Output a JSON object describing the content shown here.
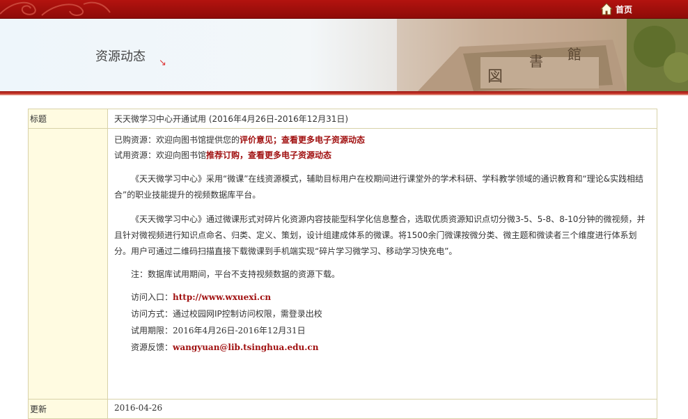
{
  "header": {
    "home_label": "首页"
  },
  "banner": {
    "title": "资源动态",
    "arrow": "↘"
  },
  "record": {
    "title_label": "标题",
    "title_value": "天天微学习中心开通试用 (2016年4月26日-2016年12月31日)",
    "purchased_prefix": "已购资源：欢迎向图书馆提供您的",
    "purchased_link1": "评价意见",
    "purchased_sep": "；",
    "purchased_link2": "查看更多电子资源动态",
    "trial_prefix": "试用资源：欢迎向图书馆",
    "trial_link1": "推荐订购",
    "trial_sep": "，",
    "trial_link2": "查看更多电子资源动态",
    "para1": "《天天微学习中心》采用“微课”在线资源模式，辅助目标用户在校期间进行课堂外的学术科研、学科教学领域的通识教育和“理论&实践相结合”的职业技能提升的视频数据库平台。",
    "para2": "《天天微学习中心》通过微课形式对碎片化资源内容技能型科学化信息整合，选取优质资源知识点切分微3-5、5-8、8-10分钟的微视频，并且针对微视频进行知识点命名、归类、定义、策划，设计组建成体系的微课。将1500余门微课按微分类、微主题和微读者三个维度进行体系划分。用户可通过二维码扫描直接下载微课到手机端实现“碎片学习微学习、移动学习快充电”。",
    "note": "注：数据库试用期间，平台不支持视频数据的资源下载。",
    "access_label": "访问入口：",
    "access_url": "http://www.wxuexi.cn",
    "method_label": "访问方式：",
    "method_value": "通过校园网IP控制访问权限，需登录出校",
    "period_label": "试用期限：",
    "period_value": "2016年4月26日-2016年12月31日",
    "feedback_label": "资源反馈：",
    "feedback_email": "wangyuan@lib.tsinghua.edu.cn",
    "update_label": "更新",
    "update_value": "2016-04-26"
  },
  "colors": {
    "topbar": "#a1110c",
    "label_bg": "#fffbe1",
    "border": "#d8d2a8",
    "link_red": "#a01010"
  },
  "icons": [
    "home-icon",
    "arrow-icon"
  ]
}
